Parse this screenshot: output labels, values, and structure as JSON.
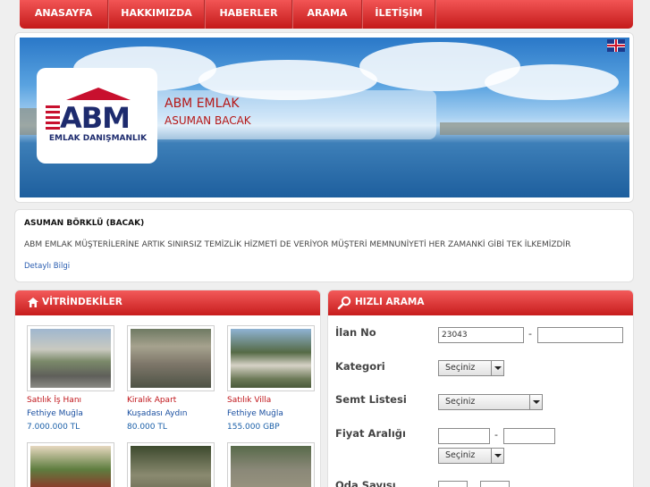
{
  "nav": {
    "items": [
      {
        "label": "ANASAYFA"
      },
      {
        "label": "HAKKIMIZDA"
      },
      {
        "label": "HABERLER"
      },
      {
        "label": "ARAMA"
      },
      {
        "label": "İLETİŞİM"
      }
    ]
  },
  "banner": {
    "logo_text": "ABM",
    "logo_subtitle": "EMLAK DANIŞMANLIK",
    "company_name": "ABM EMLAK",
    "owner_name": "ASUMAN BACAK",
    "language_flag_icon": "uk-flag-icon"
  },
  "info": {
    "title": "ASUMAN BÖRKLÜ (BACAK)",
    "text": "ABM EMLAK MÜŞTERİLERİNE ARTIK SINIRSIZ TEMİZLİK HİZMETİ DE VERİYOR MÜŞTERİ MEMNUNİYETİ HER ZAMANKİ GİBİ TEK İLKEMİZDİR",
    "link": "Detaylı Bilgi"
  },
  "showcase": {
    "title": "VİTRİNDEKİLER",
    "icon": "house-icon",
    "items": [
      {
        "type": "Satılık İş Hanı",
        "location": "Fethiye Muğla",
        "price": "7.000.000 TL"
      },
      {
        "type": "Kiralık Apart",
        "location": "Kuşadası Aydın",
        "price": "80.000 TL"
      },
      {
        "type": "Satılık Villa",
        "location": "Fethiye Muğla",
        "price": "155.000 GBP"
      },
      {
        "type": "",
        "location": "",
        "price": ""
      },
      {
        "type": "",
        "location": "",
        "price": ""
      },
      {
        "type": "",
        "location": "",
        "price": ""
      }
    ]
  },
  "quick_search": {
    "title": "HIZLI ARAMA",
    "icon": "search-icon",
    "listing_no_label": "İlan No",
    "listing_no_value": "23043",
    "listing_no_to_value": "",
    "range_separator": "-",
    "category_label": "Kategori",
    "category_selected": "Seçiniz",
    "district_label": "Semt Listesi",
    "district_selected": "Seçiniz",
    "price_range_label": "Fiyat Aralığı",
    "price_min": "",
    "price_max": "",
    "currency_selected": "Seçiniz",
    "rooms_label": "Oda Sayısı"
  }
}
